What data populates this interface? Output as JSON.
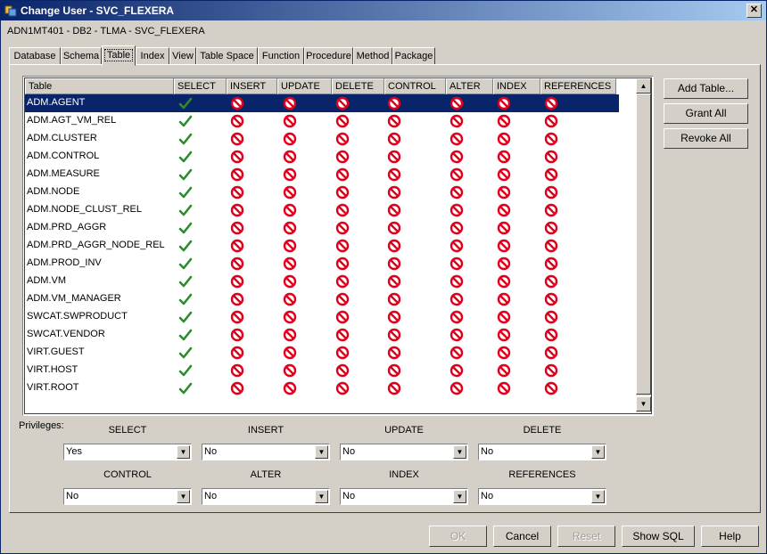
{
  "window": {
    "title": "Change User - SVC_FLEXERA",
    "close_glyph": "✕"
  },
  "connection_label": "ADN1MT401 - DB2 - TLMA - SVC_FLEXERA",
  "tabs": [
    "Database",
    "Schema",
    "Table",
    "Index",
    "View",
    "Table Space",
    "Function",
    "Procedure",
    "Method",
    "Package"
  ],
  "active_tab": "Table",
  "grid": {
    "columns": [
      "Table",
      "SELECT",
      "INSERT",
      "UPDATE",
      "DELETE",
      "CONTROL",
      "ALTER",
      "INDEX",
      "REFERENCES"
    ],
    "rows": [
      {
        "name": "ADM.AGENT",
        "selected": true
      },
      {
        "name": "ADM.AGT_VM_REL"
      },
      {
        "name": "ADM.CLUSTER"
      },
      {
        "name": "ADM.CONTROL"
      },
      {
        "name": "ADM.MEASURE"
      },
      {
        "name": "ADM.NODE"
      },
      {
        "name": "ADM.NODE_CLUST_REL"
      },
      {
        "name": "ADM.PRD_AGGR"
      },
      {
        "name": "ADM.PRD_AGGR_NODE_REL"
      },
      {
        "name": "ADM.PROD_INV"
      },
      {
        "name": "ADM.VM"
      },
      {
        "name": "ADM.VM_MANAGER"
      },
      {
        "name": "SWCAT.SWPRODUCT"
      },
      {
        "name": "SWCAT.VENDOR"
      },
      {
        "name": "VIRT.GUEST"
      },
      {
        "name": "VIRT.HOST"
      },
      {
        "name": "VIRT.ROOT"
      }
    ],
    "cell_icons": [
      "check-icon",
      "deny-icon",
      "deny-icon",
      "deny-icon",
      "deny-icon",
      "deny-icon",
      "deny-icon",
      "deny-icon"
    ]
  },
  "side_buttons": {
    "add_table": "Add Table...",
    "grant_all": "Grant All",
    "revoke_all": "Revoke All"
  },
  "privileges": {
    "label": "Privileges:",
    "fields": [
      {
        "label": "SELECT",
        "value": "Yes"
      },
      {
        "label": "INSERT",
        "value": "No"
      },
      {
        "label": "UPDATE",
        "value": "No"
      },
      {
        "label": "DELETE",
        "value": "No"
      },
      {
        "label": "CONTROL",
        "value": "No"
      },
      {
        "label": "ALTER",
        "value": "No"
      },
      {
        "label": "INDEX",
        "value": "No"
      },
      {
        "label": "REFERENCES",
        "value": "No"
      }
    ]
  },
  "buttons": {
    "ok": "OK",
    "cancel": "Cancel",
    "reset": "Reset",
    "show_sql": "Show SQL",
    "help": "Help"
  },
  "colors": {
    "selection": "#0a246a",
    "check": "#2e8b2e",
    "deny": "#e0001b"
  }
}
